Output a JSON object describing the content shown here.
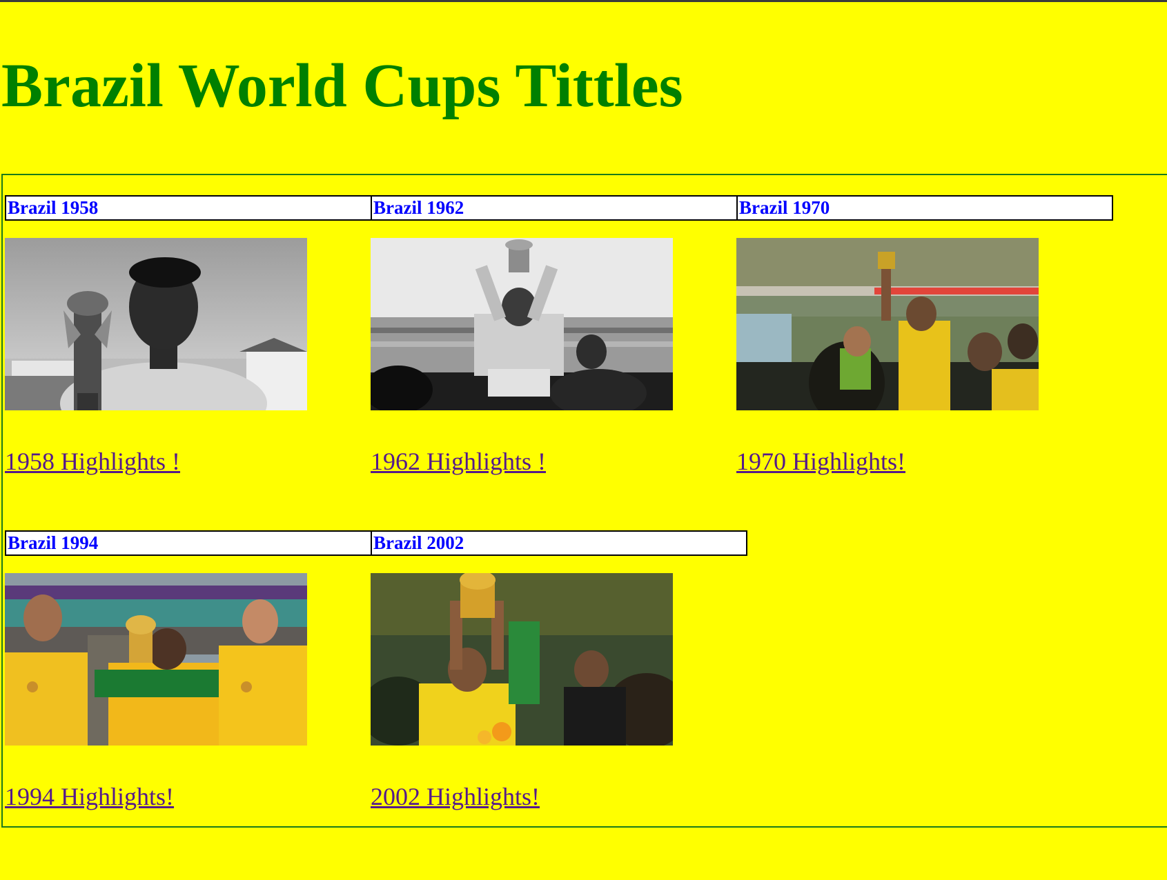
{
  "page": {
    "title": "Brazil World Cups Tittles",
    "colors": {
      "background": "#ffff00",
      "title": "#008000",
      "card_title": "#0000ff",
      "link": "#551a8b",
      "border": "#1a7a1a"
    }
  },
  "cards": [
    {
      "title": "Brazil 1958",
      "link": "1958 Highlights !",
      "photo_icon": "pele-trophy-photo"
    },
    {
      "title": "Brazil 1962",
      "link": "1962 Highlights !",
      "photo_icon": "trophy-lift-photo"
    },
    {
      "title": "Brazil 1970",
      "link": "1970 Highlights!",
      "photo_icon": "stadium-celebration-photo"
    },
    {
      "title": "Brazil 1994",
      "link": "1994 Highlights!",
      "photo_icon": "team-trophy-kiss-photo"
    },
    {
      "title": "Brazil 2002",
      "link": "2002 Highlights!",
      "photo_icon": "crowd-trophy-photo"
    }
  ]
}
